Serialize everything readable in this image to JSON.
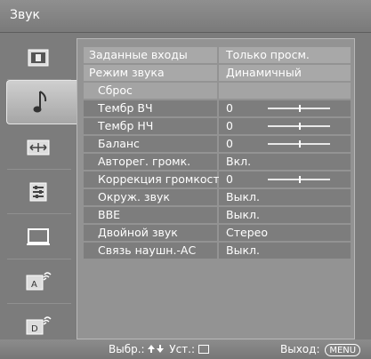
{
  "header": {
    "title": "Звук"
  },
  "sidebar": {
    "items": [
      {
        "icon": "picture-icon"
      },
      {
        "icon": "music-note-icon"
      },
      {
        "icon": "screen-icon"
      },
      {
        "icon": "settings-list-icon"
      },
      {
        "icon": "monitor-icon"
      },
      {
        "icon": "analog-setup-icon"
      },
      {
        "icon": "digital-setup-icon"
      }
    ]
  },
  "menu": {
    "rows": [
      {
        "label": "Заданные входы",
        "value": "Только просм."
      },
      {
        "label": "Режим звука",
        "value": "Динамичный"
      },
      {
        "label": "Сброс",
        "value": ""
      },
      {
        "label": "Тембр ВЧ",
        "value": "0",
        "slider": 0.5
      },
      {
        "label": "Тембр НЧ",
        "value": "0",
        "slider": 0.5
      },
      {
        "label": "Баланс",
        "value": "0",
        "slider": 0.5
      },
      {
        "label": "Авторег. громк.",
        "value": "Вкл."
      },
      {
        "label": "Коррекция громкости",
        "value": "0",
        "slider": 0.5
      },
      {
        "label": "Окруж. звук",
        "value": "Выкл."
      },
      {
        "label": "BBE",
        "value": "Выкл."
      },
      {
        "label": "Двойной звук",
        "value": "Стерео"
      },
      {
        "label": "Связь наушн.-АС",
        "value": "Выкл."
      }
    ]
  },
  "footer": {
    "select_label": "Выбр.:",
    "set_label": "Уст.:",
    "exit_label": "Выход:",
    "menu_key": "MENU"
  }
}
